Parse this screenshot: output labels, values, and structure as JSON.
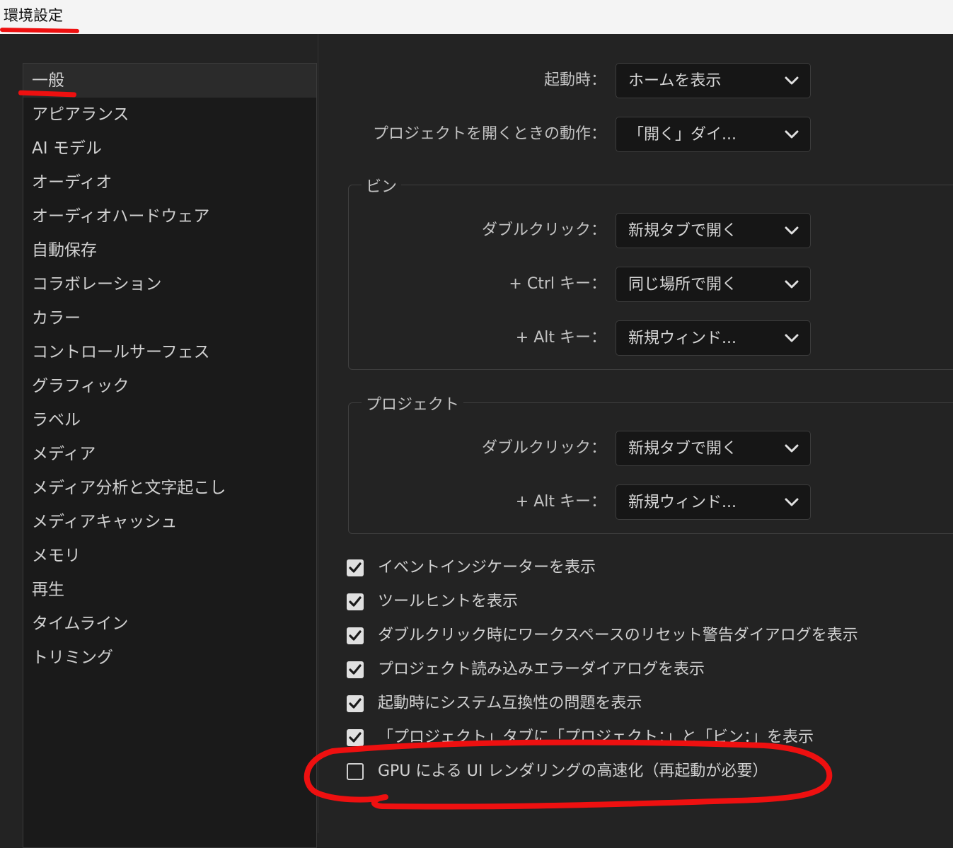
{
  "window": {
    "title": "環境設定"
  },
  "colors": {
    "annotation": "#ee1010",
    "background": "#232323",
    "sidebar": "#1a1a1a"
  },
  "sidebar": {
    "items": [
      "一般",
      "アピアランス",
      "AI モデル",
      "オーディオ",
      "オーディオハードウェア",
      "自動保存",
      "コラボレーション",
      "カラー",
      "コントロールサーフェス",
      "グラフィック",
      "ラベル",
      "メディア",
      "メディア分析と文字起こし",
      "メディアキャッシュ",
      "メモリ",
      "再生",
      "タイムライン",
      "トリミング"
    ],
    "active": "一般"
  },
  "general": {
    "startup": {
      "label": "起動時：",
      "value": "ホームを表示",
      "icon": "chevron-down-icon"
    },
    "open_project": {
      "label": "プロジェクトを開くときの動作：",
      "value": "「開く」ダイ..."
    }
  },
  "bin_group": {
    "title": "ビン",
    "double_click": {
      "label": "ダブルクリック：",
      "value": "新規タブで開く"
    },
    "ctrl_key": {
      "label": "+ Ctrl キー：",
      "value": "同じ場所で開く"
    },
    "alt_key": {
      "label": "+ Alt キー：",
      "value": "新規ウィンド..."
    }
  },
  "project_group": {
    "title": "プロジェクト",
    "double_click": {
      "label": "ダブルクリック：",
      "value": "新規タブで開く"
    },
    "alt_key": {
      "label": "+ Alt キー：",
      "value": "新規ウィンド..."
    }
  },
  "checkboxes": [
    {
      "label": "イベントインジケーターを表示",
      "checked": true
    },
    {
      "label": "ツールヒントを表示",
      "checked": true
    },
    {
      "label": "ダブルクリック時にワークスペースのリセット警告ダイアログを表示",
      "checked": true
    },
    {
      "label": "プロジェクト読み込みエラーダイアログを表示",
      "checked": true
    },
    {
      "label": "起動時にシステム互換性の問題を表示",
      "checked": true
    },
    {
      "label": "「プロジェクト」タブに「プロジェクト：」と「ビン：」を表示",
      "checked": true
    },
    {
      "label": "GPU による UI レンダリングの高速化（再起動が必要）",
      "checked": false
    }
  ]
}
